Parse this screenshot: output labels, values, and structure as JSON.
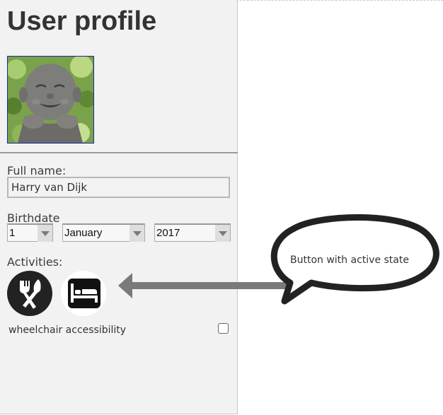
{
  "page": {
    "title": "User profile"
  },
  "profile": {
    "avatar_alt": "smiling stone buddha statue",
    "full_name_label": "Full name:",
    "full_name_value": "Harry van Dijk",
    "birthdate_label": "Birthdate",
    "birth_day": "1",
    "birth_month": "January",
    "birth_year": "2017"
  },
  "activities": {
    "label": "Activities:",
    "items": [
      {
        "icon": "fork-knife-icon",
        "name": "dining",
        "active": false
      },
      {
        "icon": "bed-icon",
        "name": "lodging",
        "active": true
      }
    ]
  },
  "accessibility": {
    "wheelchair_label": "wheelchair accessibility",
    "wheelchair_checked": false
  },
  "annotation": {
    "callout_text": "Button with active state"
  },
  "colors": {
    "panel_bg": "#f2f2f2",
    "button_dark": "#222222",
    "arrow": "#7a7a7a",
    "bubble_stroke": "#222222"
  }
}
